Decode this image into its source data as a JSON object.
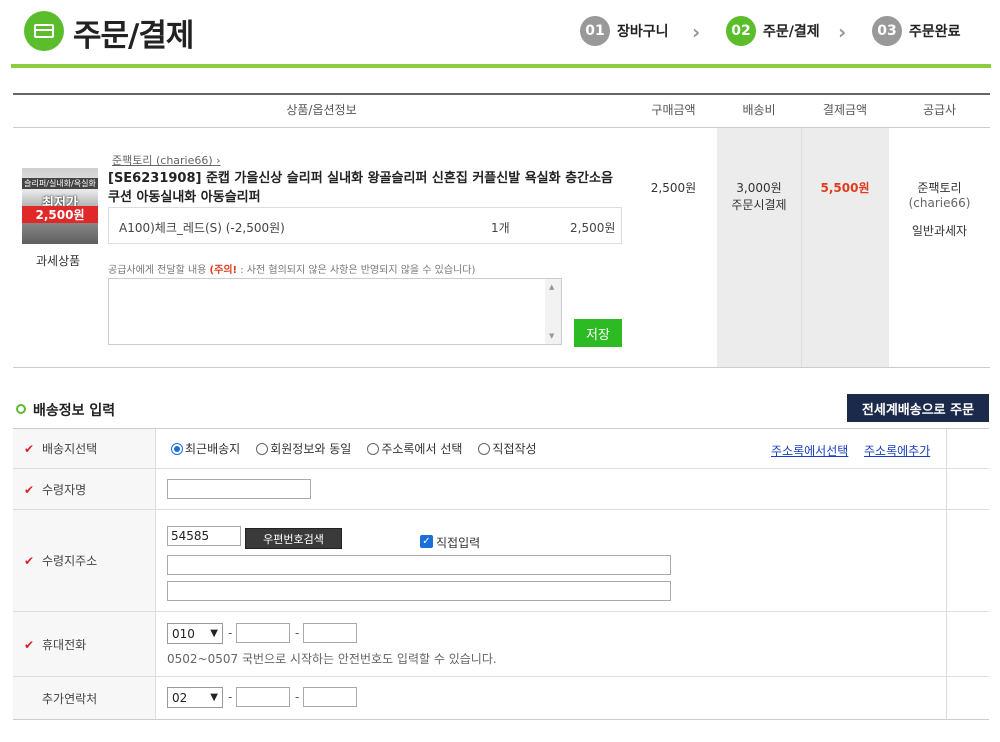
{
  "header": {
    "title": "주문/결제",
    "steps": [
      {
        "num": "01",
        "label": "장바구니"
      },
      {
        "num": "02",
        "label": "주문/결제"
      },
      {
        "num": "03",
        "label": "주문완료"
      }
    ]
  },
  "table": {
    "headers": [
      "상품/옵션정보",
      "구매금액",
      "배송비",
      "결제금액",
      "공급사"
    ]
  },
  "product": {
    "thumb_text1": "슬리퍼/실내화/욕실화",
    "thumb_text2": "최저가",
    "thumb_text3": "2,500원",
    "tax_type": "과세상품",
    "supplier_link": "준팩토리 (charie66)",
    "name": "[SE6231908] 준캡 가을신상 슬리퍼 실내화 왕골슬리퍼 신혼집 커플신발 욕실화 층간소음 쿠션 아동실내화 아동슬리퍼",
    "option_name": "A100)체크_레드(S) (-2,500원)",
    "option_qty": "1개",
    "option_price": "2,500원",
    "memo_label": "공급사에게 전달할 내용",
    "memo_warn": "(주의!",
    "memo_warn_rest": " : 사전 협의되지 않은 사항은 반영되지 않을 수 있습니다)",
    "save_button": "저장",
    "purchase_amount": "2,500원",
    "shipping_fee": "3,000원",
    "shipping_note": "주문시결제",
    "payment_amount": "5,500원",
    "supplier_name": "준팩토리",
    "supplier_id": "(charie66)",
    "supplier_type": "일반과세자"
  },
  "shipping": {
    "title": "배송정보 입력",
    "world_button": "전세계배송으로 주문",
    "labels": {
      "destination": "배송지선택",
      "receiver": "수령자명",
      "address": "수령지주소",
      "mobile": "휴대전화",
      "extra": "추가연락처"
    },
    "radios": [
      "최근배송지",
      "회원정보와 동일",
      "주소록에서 선택",
      "직접작성"
    ],
    "selected_radio": "최근배송지",
    "link_select": "주소록에서선택",
    "link_add": "주소록에추가",
    "zip_value": "54585",
    "zip_button": "우편번호검색",
    "direct_input_label": "직접입력",
    "direct_input_checked": true,
    "mobile_prefix": "010",
    "extra_prefix": "02",
    "mobile_hint": "0502~0507 국번으로 시작하는 안전번호도 입력할 수 있습니다."
  },
  "colors": {
    "brand_green": "#5bbd2b",
    "save_green": "#2dbb24",
    "price_red": "#e03c1e",
    "navy": "#1b2a4a",
    "link_blue": "#1a3fbf"
  }
}
